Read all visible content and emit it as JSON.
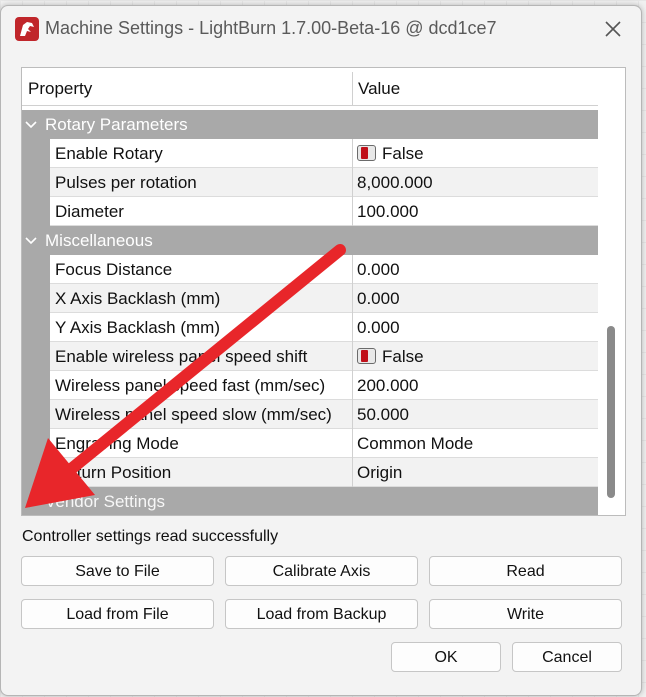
{
  "window": {
    "title": "Machine Settings - LightBurn 1.7.00-Beta-16 @ dcd1ce7",
    "app_icon": "lightburn-logo-icon",
    "close_icon": "close-icon"
  },
  "grid": {
    "columns": {
      "property": "Property",
      "value": "Value"
    },
    "groups": [
      {
        "label": "Rotary Parameters",
        "expanded": true,
        "rows": [
          {
            "name": "Enable Rotary",
            "value": "False",
            "toggle": true
          },
          {
            "name": "Pulses per rotation",
            "value": "8,000.000"
          },
          {
            "name": "Diameter",
            "value": "100.000"
          }
        ]
      },
      {
        "label": "Miscellaneous",
        "expanded": true,
        "rows": [
          {
            "name": "Focus Distance",
            "value": "0.000"
          },
          {
            "name": "X Axis Backlash (mm)",
            "value": "0.000"
          },
          {
            "name": "Y Axis Backlash (mm)",
            "value": "0.000"
          },
          {
            "name": "Enable wireless panel speed shift",
            "value": "False",
            "toggle": true
          },
          {
            "name": "Wireless panel speed fast (mm/sec)",
            "value": "200.000"
          },
          {
            "name": "Wireless panel speed slow (mm/sec)",
            "value": "50.000"
          },
          {
            "name": "Engraving Mode",
            "value": "Common Mode"
          },
          {
            "name": "Return Position",
            "value": "Origin"
          }
        ]
      },
      {
        "label": "Vendor Settings",
        "expanded": false,
        "rows": []
      }
    ]
  },
  "status": "Controller settings read successfully",
  "buttons": {
    "save_to_file": "Save to File",
    "calibrate_axis": "Calibrate Axis",
    "read": "Read",
    "load_from_file": "Load from File",
    "load_from_backup": "Load from Backup",
    "write": "Write",
    "ok": "OK",
    "cancel": "Cancel"
  },
  "colors": {
    "group_header": "#a9a9a9",
    "annotation_arrow": "#e8262a",
    "toggle_off": "#c0101a"
  }
}
